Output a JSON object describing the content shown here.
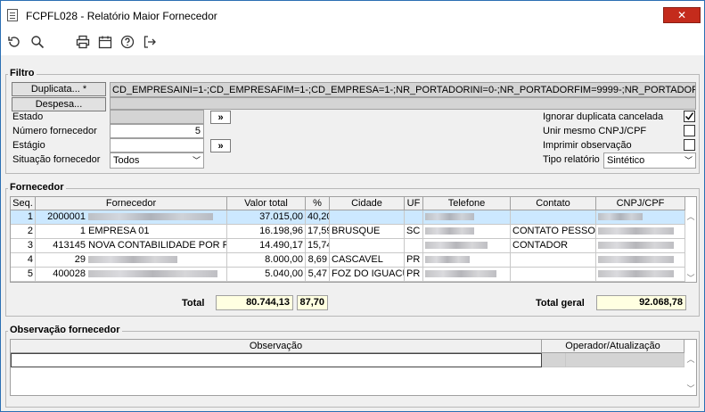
{
  "window": {
    "title": "FCPFL028 - Relatório Maior Fornecedor",
    "close_label": "✕"
  },
  "toolbar": {
    "icons": [
      "refresh-icon",
      "search-icon",
      "print-icon",
      "calendar-icon",
      "help-icon",
      "exit-icon"
    ]
  },
  "filtro": {
    "title": "Filtro",
    "duplicata_button": "Duplicata... *",
    "despesa_button": "Despesa...",
    "filter_string": "CD_EMPRESAINI=1-;CD_EMPRESAFIM=1-;CD_EMPRESA=1-;NR_PORTADORINI=0-;NR_PORTADORFIM=9999-;NR_PORTADOR=-;CD_FOR",
    "estado_label": "Estado",
    "numero_label": "Número fornecedor",
    "numero_value": "5",
    "estagio_label": "Estágio",
    "situacao_label": "Situação fornecedor",
    "situacao_value": "Todos",
    "more_button": "»",
    "ignorar_label": "Ignorar duplicata cancelada",
    "ignorar_checked": true,
    "unir_label": "Unir mesmo CNPJ/CPF",
    "unir_checked": false,
    "imprimir_label": "Imprimir observação",
    "imprimir_checked": false,
    "tipo_label": "Tipo relatório",
    "tipo_value": "Sintético"
  },
  "fornecedor": {
    "title": "Fornecedor",
    "columns": [
      "Seq.",
      "Fornecedor",
      "Valor total",
      "%",
      "Cidade",
      "UF",
      "Telefone",
      "Contato",
      "CNPJ/CPF"
    ],
    "rows": [
      {
        "seq": "1",
        "codigo": "2000001",
        "nome": "",
        "valor": "37.015,00",
        "pct": "40,20",
        "cidade": "",
        "uf": "",
        "contato": ""
      },
      {
        "seq": "2",
        "codigo": "1",
        "nome": "EMPRESA 01",
        "valor": "16.198,96",
        "pct": "17,59",
        "cidade": "BRUSQUE",
        "uf": "SC",
        "contato": "CONTATO PESSOA"
      },
      {
        "seq": "3",
        "codigo": "413145",
        "nome": "NOVA CONTABILIDADE POR F",
        "valor": "14.490,17",
        "pct": "15,74",
        "cidade": "",
        "uf": "",
        "contato": "CONTADOR"
      },
      {
        "seq": "4",
        "codigo": "29",
        "nome": "",
        "valor": "8.000,00",
        "pct": "8,69",
        "cidade": "CASCAVEL",
        "uf": "PR",
        "contato": ""
      },
      {
        "seq": "5",
        "codigo": "400028",
        "nome": "",
        "valor": "5.040,00",
        "pct": "5,47",
        "cidade": "FOZ DO IGUACU",
        "uf": "PR",
        "contato": ""
      }
    ],
    "total_label": "Total",
    "total_valor": "80.744,13",
    "total_pct": "87,70",
    "total_geral_label": "Total geral",
    "total_geral_valor": "92.068,78"
  },
  "observacao": {
    "title": "Observação fornecedor",
    "col_obs": "Observação",
    "col_oper": "Operador/Atualização"
  }
}
